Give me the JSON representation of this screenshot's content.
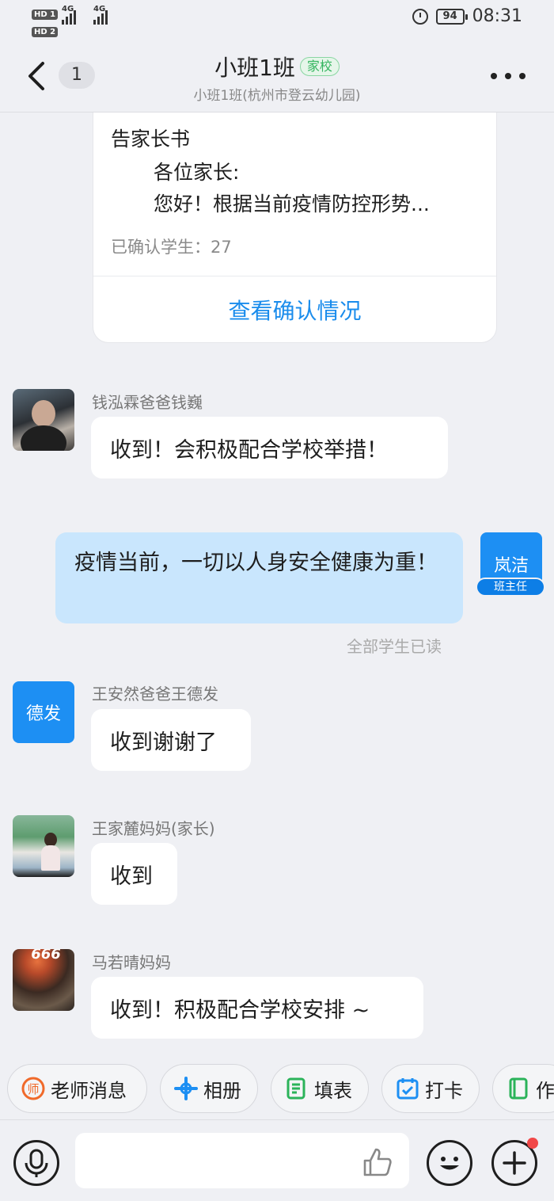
{
  "status_bar": {
    "sim1": "HD 1",
    "sim2": "HD 2",
    "network1": "4G",
    "network2": "4G",
    "battery": "94",
    "time": "08:31"
  },
  "header": {
    "unread_count": "1",
    "title": "小班1班",
    "tag": "家校",
    "subtitle": "小班1班(杭州市登云幼儿园)"
  },
  "notice": {
    "title": "告家长书",
    "line1": "各位家长:",
    "line2": "您好！根据当前疫情防控形势...",
    "confirmed": "已确认学生：27",
    "link": "查看确认情况"
  },
  "messages": [
    {
      "sender": "钱泓霖爸爸钱巍",
      "text": "收到！会积极配合学校举措！"
    },
    {
      "sender": "王安然爸爸王德发",
      "text": "收到谢谢了",
      "avatar_text": "德发"
    },
    {
      "sender": "王家麓妈妈(家长)",
      "text": "收到"
    },
    {
      "sender": "马若晴妈妈",
      "text": "收到！积极配合学校安排 ~",
      "avatar_overlay": "666"
    }
  ],
  "outgoing": {
    "text": "疫情当前，一切以人身安全健康为重！",
    "avatar_text": "岚洁",
    "role": "班主任",
    "read_status": "全部学生已读"
  },
  "quick_actions": [
    {
      "label": "老师消息",
      "icon": "teacher-icon",
      "color": "#f06a2b",
      "icon_char": "师"
    },
    {
      "label": "相册",
      "icon": "album-icon",
      "color": "#1d8ff3"
    },
    {
      "label": "填表",
      "icon": "form-icon",
      "color": "#2bb35a"
    },
    {
      "label": "打卡",
      "icon": "checkin-icon",
      "color": "#1d8ff3"
    },
    {
      "label": "作",
      "icon": "homework-icon",
      "color": "#2bb35a"
    }
  ],
  "input": {
    "placeholder": ""
  },
  "colors": {
    "accent": "#1a8cec",
    "outgoing_bubble": "#c9e6fd",
    "background": "#eff0f4"
  }
}
